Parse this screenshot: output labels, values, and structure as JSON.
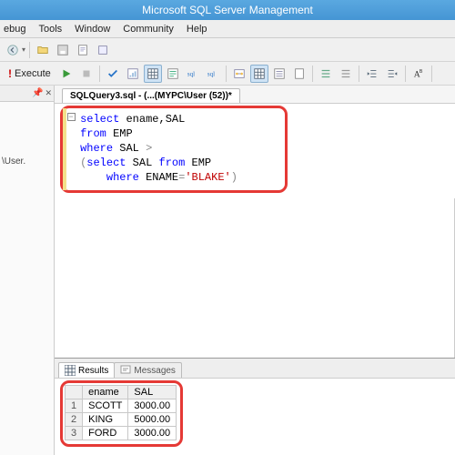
{
  "titlebar": {
    "title": "Microsoft SQL Server Management"
  },
  "menu": {
    "items": [
      "ebug",
      "Tools",
      "Window",
      "Community",
      "Help"
    ]
  },
  "toolbar": {
    "execute_label": "Execute"
  },
  "sidepanel": {
    "tree_label": "\\User."
  },
  "tab": {
    "title": "SQLQuery3.sql - (...(MYPC\\User (52))*"
  },
  "sql": {
    "l1a": "select",
    "l1b": " ename,SAL",
    "l2a": "from",
    "l2b": " EMP",
    "l3a": "where",
    "l3b": " SAL ",
    "l3c": ">",
    "l4a": "(",
    "l4b": "select",
    "l4c": " SAL ",
    "l4d": "from",
    "l4e": " EMP",
    "l5a": "where",
    "l5b": " ENAME",
    "l5c": "=",
    "l5d": "'BLAKE'",
    "l5e": ")"
  },
  "results": {
    "tab_results": "Results",
    "tab_messages": "Messages",
    "columns": [
      "",
      "ename",
      "SAL"
    ],
    "rows": [
      {
        "n": "1",
        "ename": "SCOTT",
        "sal": "3000.00"
      },
      {
        "n": "2",
        "ename": "KING",
        "sal": "5000.00"
      },
      {
        "n": "3",
        "ename": "FORD",
        "sal": "3000.00"
      }
    ]
  }
}
